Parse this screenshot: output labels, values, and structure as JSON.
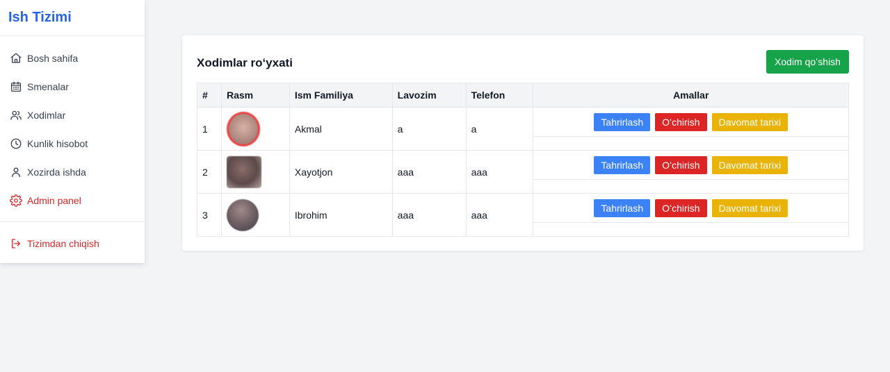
{
  "app": {
    "title": "Ish Tizimi"
  },
  "sidebar": {
    "items": [
      {
        "label": "Bosh sahifa",
        "icon": "home-icon"
      },
      {
        "label": "Smenalar",
        "icon": "calendar-icon"
      },
      {
        "label": "Xodimlar",
        "icon": "users-icon"
      },
      {
        "label": "Kunlik hisobot",
        "icon": "clock-icon"
      },
      {
        "label": "Xozirda ishda",
        "icon": "user-icon"
      },
      {
        "label": "Admin panel",
        "icon": "gear-icon"
      }
    ],
    "logout": {
      "label": "Tizimdan chiqish",
      "icon": "logout-icon"
    }
  },
  "main": {
    "title": "Xodimlar roʻyxati",
    "add_button": "Xodim qoʻshish",
    "columns": [
      "#",
      "Rasm",
      "Ism Familiya",
      "Lavozim",
      "Telefon",
      "Amallar"
    ],
    "rows": [
      {
        "num": "1",
        "name": "Akmal",
        "position": "a",
        "phone": "a"
      },
      {
        "num": "2",
        "name": "Xayotjon",
        "position": "aaa",
        "phone": "aaa"
      },
      {
        "num": "3",
        "name": "Ibrohim",
        "position": "aaa",
        "phone": "aaa"
      }
    ],
    "actions": {
      "edit": "Tahrirlash",
      "delete": "Oʻchirish",
      "history": "Davomat tarixi"
    }
  },
  "colors": {
    "brand": "#2563eb",
    "add": "#16a34a",
    "edit": "#3b82f6",
    "delete": "#dc2626",
    "history": "#eab308"
  }
}
